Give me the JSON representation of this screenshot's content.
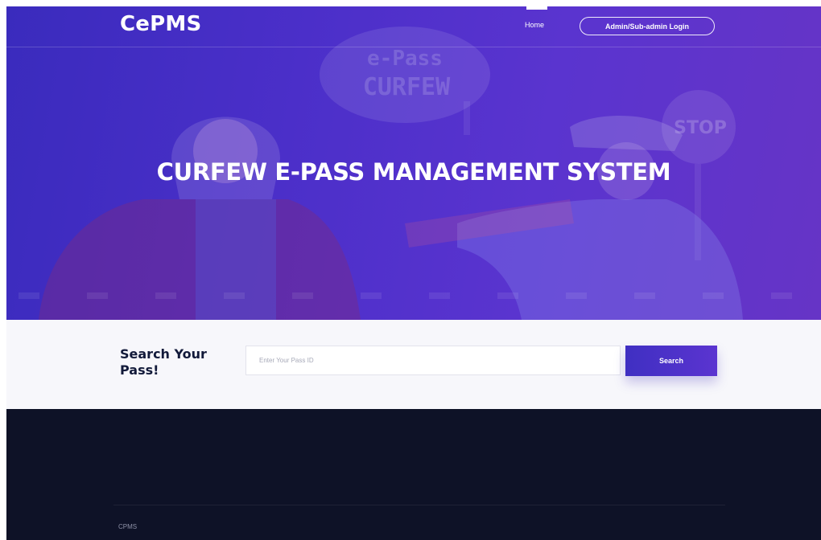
{
  "brand": "CePMS",
  "nav": {
    "home_label": "Home",
    "login_label": "Admin/Sub-admin Login"
  },
  "hero": {
    "title": "CURFEW E-PASS MANAGEMENT SYSTEM",
    "sign_text_line1": "e-Pass",
    "sign_text_line2": "CURFEW",
    "stop_sign_text": "STOP"
  },
  "search": {
    "heading": "Search Your Pass!",
    "placeholder": "Enter Your Pass ID",
    "value": "",
    "button_label": "Search"
  },
  "footer": {
    "text": "CPMS"
  },
  "colors": {
    "hero_gradient_start": "#3a2bbd",
    "hero_gradient_end": "#6634c6",
    "search_bg": "#f7f7fb",
    "heading": "#121a3a",
    "button": "#4a31c8",
    "footer_bg": "#0e1227"
  }
}
